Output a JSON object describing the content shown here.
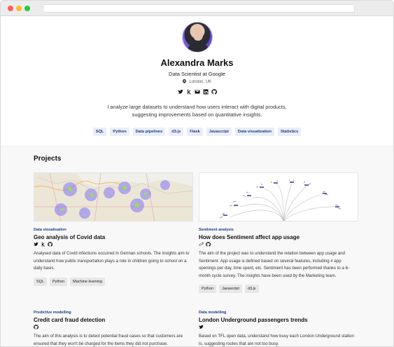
{
  "profile": {
    "name": "Alexandra Marks",
    "role": "Data Scientist at Google",
    "location": "London, UK",
    "intro": "I analyze large datasets to understand how users interact with digital products, suggesting improvements based on quantitative insights.",
    "social_icons": [
      "twitter-icon",
      "kaggle-icon",
      "email-icon",
      "linkedin-icon",
      "github-icon"
    ]
  },
  "skills": [
    "SQL",
    "Python",
    "Data pipelines",
    "d3.js",
    "Flask",
    "Javascript",
    "Data visualization",
    "Statistics"
  ],
  "projects_section": {
    "title": "Projects",
    "items": [
      {
        "category": "Data visualisation",
        "title": "Geo analysis of Covid data",
        "links": [
          "twitter-icon",
          "kaggle-icon",
          "github-icon"
        ],
        "description": "Analysed data of Covid infections occurred in German schools. The insights aim to understand how public transportation plays a role in children going to school on a daily basis.",
        "tags": [
          "SQL",
          "Python",
          "Machine learning"
        ],
        "thumb_type": "map"
      },
      {
        "category": "Sentiment analysis",
        "title": "How does Sentiment affect app usage",
        "links": [
          "link-icon",
          "github-icon"
        ],
        "description": "The aim of the project was to understand the relation between app usage and Sentiment. App usage is defined based on several features, including # app openings per day, time spent, etc. Sentiment has been performed thanks to a 6-month cycle survey. The insights have been used by the Marketing team.",
        "tags": [
          "Python",
          "Javascript",
          "d3.js"
        ],
        "thumb_type": "tree"
      },
      {
        "category": "Predictive modelling",
        "title": "Credit card fraud detection",
        "links": [
          "github-icon"
        ],
        "description": "The aim of this analysis is to detect potential fraud cases so that customers are ensured that they won't be charged for the items they did not purchase.",
        "tags": [],
        "thumb_type": "none"
      },
      {
        "category": "Data modelling",
        "title": "London Underground passengers trends",
        "links": [
          "twitter-icon"
        ],
        "description": "Based on TFL open data, understand how busy each London Underground station is, suggesting routes that are not too busy.",
        "tags": [],
        "thumb_type": "none"
      }
    ]
  },
  "colors": {
    "tag_text": "#1e3a8a",
    "tag_bg": "#e9eef8",
    "chip_bg": "#e7e7e7"
  }
}
